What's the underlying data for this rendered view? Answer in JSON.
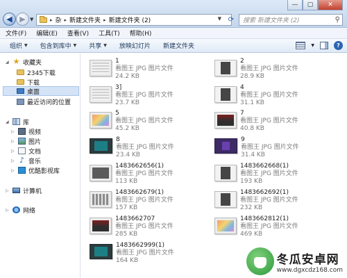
{
  "window": {
    "minimize": "—",
    "maximize": "▢",
    "close": "✕"
  },
  "address": {
    "crumbs": [
      "杂",
      "新建文件夹",
      "新建文件夹 (2)"
    ],
    "separator": "▸"
  },
  "search": {
    "placeholder": "搜索 新建文件夹 (2)"
  },
  "menu": [
    "文件(F)",
    "编辑(E)",
    "查看(V)",
    "工具(T)",
    "帮助(H)"
  ],
  "toolbar": {
    "organize": "组织",
    "include": "包含到库中",
    "share": "共享",
    "slideshow": "放映幻灯片",
    "new_folder": "新建文件夹"
  },
  "nav": {
    "favorites": "收藏夹",
    "fav_items": [
      "2345下载",
      "下载",
      "桌面",
      "最近访问的位置"
    ],
    "libraries": "库",
    "lib_items": [
      "视频",
      "图片",
      "文档",
      "音乐",
      "优酷影视库"
    ],
    "computer": "计算机",
    "network": "网络"
  },
  "files": [
    {
      "name": "1",
      "type": "看图王 JPG 图片文件",
      "size": "24.2 KB",
      "icon": "gray-doc-thumbnail"
    },
    {
      "name": "2",
      "type": "看图王 JPG 图片文件",
      "size": "28.9 KB",
      "icon": "dark-phone-thumbnail"
    },
    {
      "name": "3]",
      "type": "看图王 JPG 图片文件",
      "size": "23.7 KB",
      "icon": "gray-doc-thumbnail"
    },
    {
      "name": "4",
      "type": "看图王 JPG 图片文件",
      "size": "31.1 KB",
      "icon": "dark-phone-thumbnail"
    },
    {
      "name": "5",
      "type": "看图王 JPG 图片文件",
      "size": "45.2 KB",
      "icon": "color-thumbnail"
    },
    {
      "name": "7",
      "type": "看图王 JPG 图片文件",
      "size": "40.8 KB",
      "icon": "dark-red-thumbnail"
    },
    {
      "name": "8",
      "type": "看图王 JPG 图片文件",
      "size": "23.4 KB",
      "icon": "teal-thumbnail"
    },
    {
      "name": "9",
      "type": "看图王 JPG 图片文件",
      "size": "31.4 KB",
      "icon": "purple-thumbnail"
    },
    {
      "name": "1483662656(1)",
      "type": "看图王 JPG 图片文件",
      "size": "113 KB",
      "icon": "dark-thumbnail"
    },
    {
      "name": "1483662668(1)",
      "type": "看图王 JPG 图片文件",
      "size": "193 KB",
      "icon": "dark-phone-thumbnail"
    },
    {
      "name": "1483662679(1)",
      "type": "看图王 JPG 图片文件",
      "size": "157 KB",
      "icon": "shelf-thumbnail"
    },
    {
      "name": "1483662692(1)",
      "type": "看图王 JPG 图片文件",
      "size": "232 KB",
      "icon": "dark-phone-thumbnail"
    },
    {
      "name": "1483662707",
      "type": "看图王 JPG 图片文件",
      "size": "285 KB",
      "icon": "dark-red-thumbnail"
    },
    {
      "name": "1483662812(1)",
      "type": "看图王 JPG 图片文件",
      "size": "469 KB",
      "icon": "color-thumbnail"
    },
    {
      "name": "1483662999(1)",
      "type": "看图王 JPG 图片文件",
      "size": "164 KB",
      "icon": "teal-thumbnail"
    }
  ],
  "watermark": {
    "title": "冬瓜安卓网",
    "url": "www.dgxcdz168.com"
  }
}
